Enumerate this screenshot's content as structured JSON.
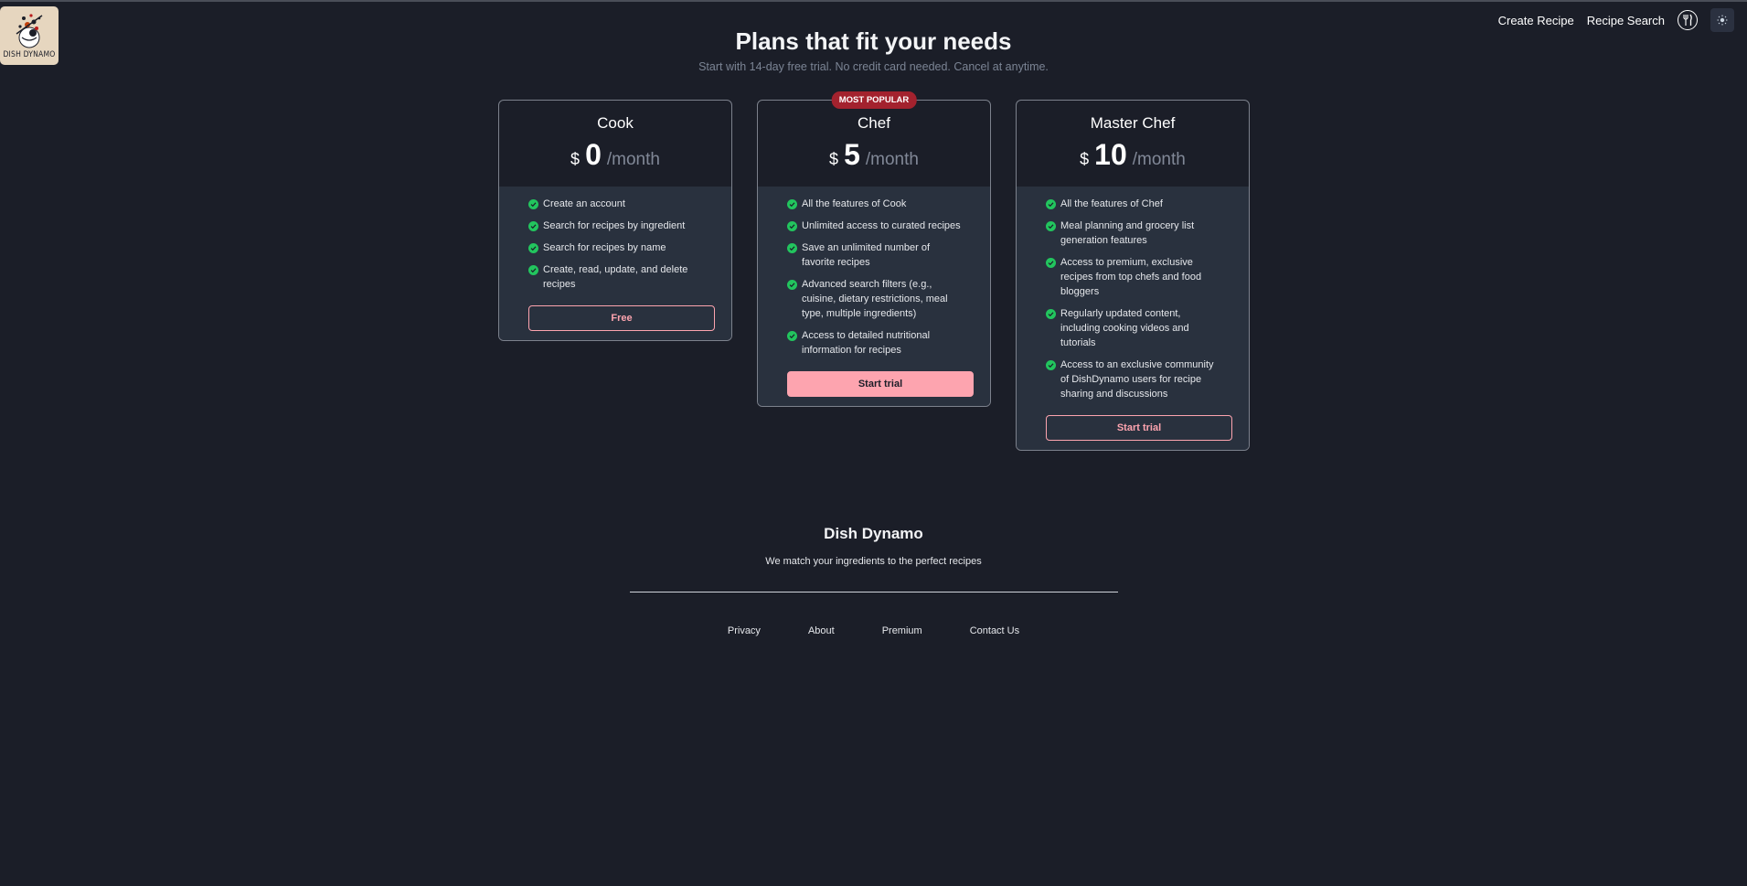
{
  "brand": {
    "name": "DISH DYNAMO"
  },
  "nav": {
    "items": [
      {
        "label": "Create Recipe"
      },
      {
        "label": "Recipe Search"
      }
    ],
    "avatar_icon": "fork-knife-icon",
    "theme_icon": "sun-icon"
  },
  "header": {
    "title": "Plans that fit your needs",
    "subtitle": "Start with 14-day free trial. No credit card needed. Cancel at anytime."
  },
  "plans": [
    {
      "name": "Cook",
      "currency": "$",
      "amount": "0",
      "period": "/month",
      "features": [
        "Create an account",
        "Search for recipes by ingredient",
        "Search for recipes by name",
        "Create, read, update, and delete recipes"
      ],
      "button": "Free"
    },
    {
      "name": "Chef",
      "badge": "MOST POPULAR",
      "currency": "$",
      "amount": "5",
      "period": "/month",
      "features": [
        "All the features of Cook",
        "Unlimited access to curated recipes",
        "Save an unlimited number of favorite recipes",
        "Advanced search filters (e.g., cuisine, dietary restrictions, meal type, multiple ingredients)",
        "Access to detailed nutritional information for recipes"
      ],
      "button": "Start trial"
    },
    {
      "name": "Master Chef",
      "currency": "$",
      "amount": "10",
      "period": "/month",
      "features": [
        "All the features of Chef",
        "Meal planning and grocery list generation features",
        "Access to premium, exclusive recipes from top chefs and food bloggers",
        "Regularly updated content, including cooking videos and tutorials",
        "Access to an exclusive community of DishDynamo users for recipe sharing and discussions"
      ],
      "button": "Start trial"
    }
  ],
  "footer": {
    "title": "Dish Dynamo",
    "tagline": "We match your ingredients to the perfect recipes",
    "links": [
      "Privacy",
      "About",
      "Premium",
      "Contact Us"
    ]
  },
  "colors": {
    "background": "#1b1e28",
    "card_body": "#29313e",
    "accent": "#fda4af",
    "badge": "#a3222e",
    "check": "#22c55e"
  }
}
